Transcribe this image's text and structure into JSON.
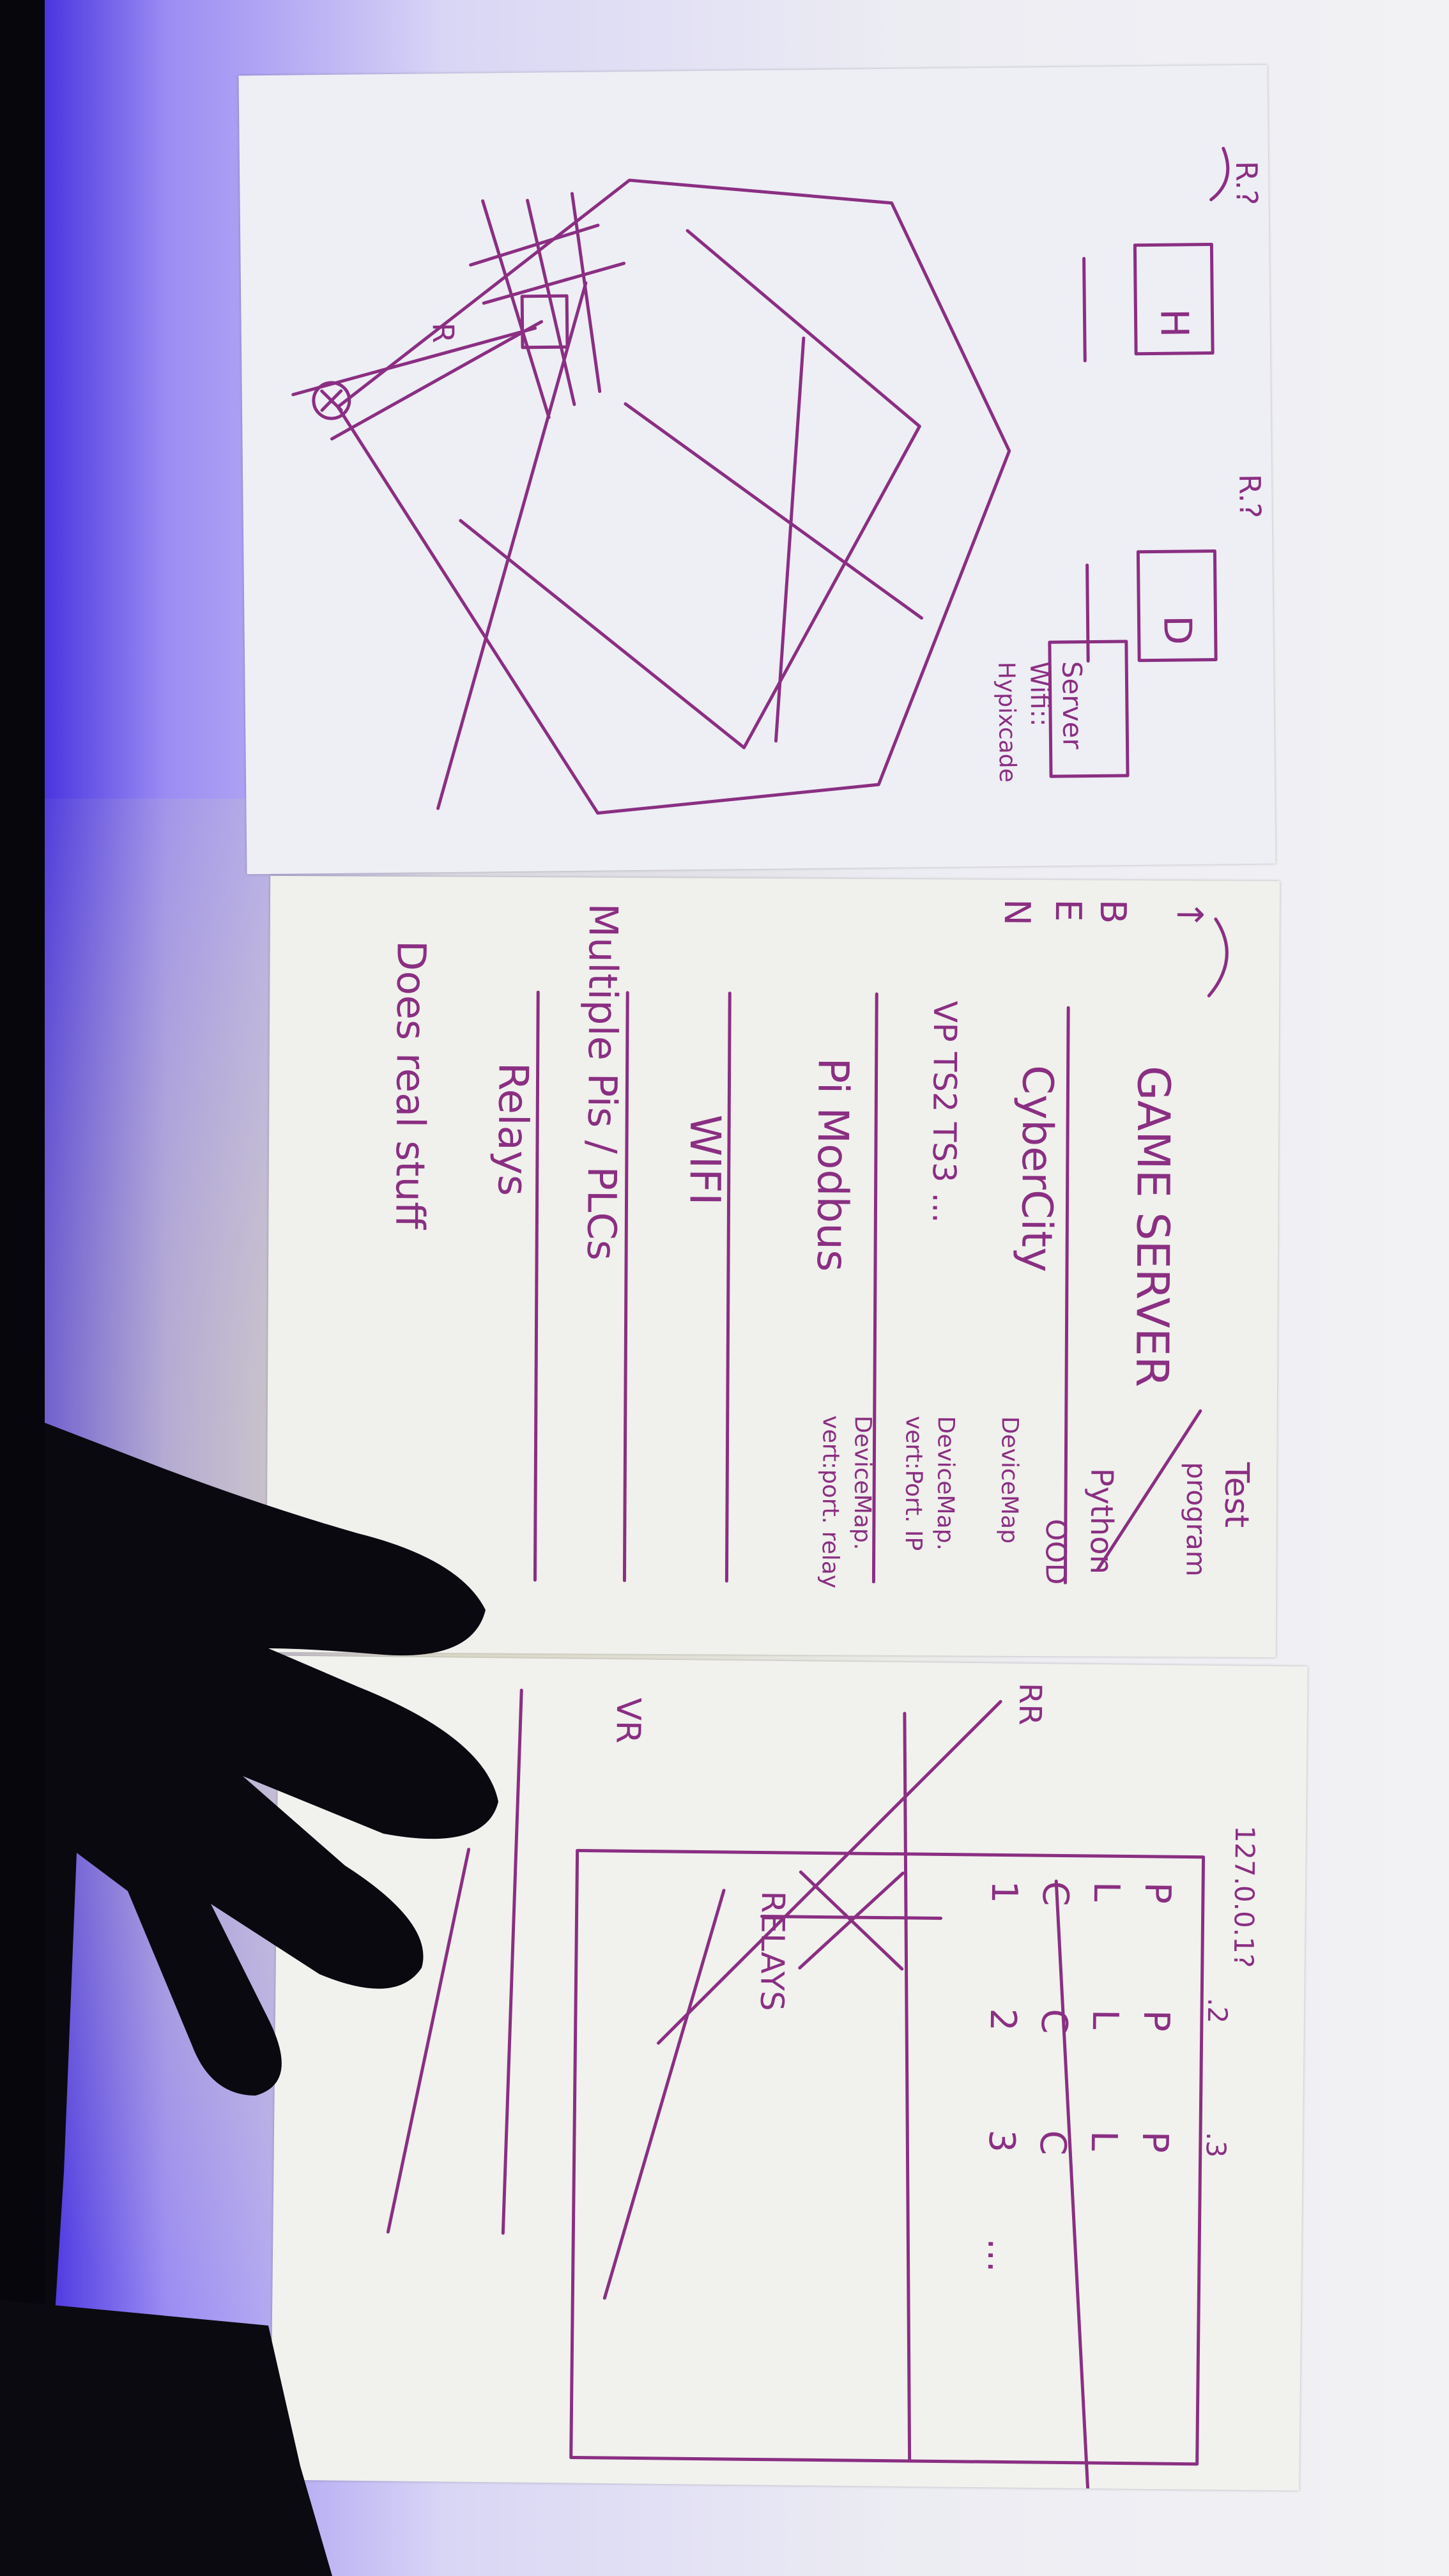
{
  "image_kind": "photo of three hand-drawn whiteboard-style sheets, photographed rotated 90 degrees",
  "ink_color": "#8a2f82",
  "sheet1": {
    "notes": [
      "R.?",
      "R.?",
      "H",
      "D",
      "R",
      "Server",
      "Wifi::",
      "Hypixcade"
    ]
  },
  "sheet2": {
    "left_column": [
      "↑",
      "B",
      "E",
      "N"
    ],
    "title": "GAME SERVER",
    "lines": [
      "CyberCity",
      "VP  TS2 TS3 ...",
      "Pi Modbus",
      "WIFI",
      "Multiple Pis / PLCs",
      "Relays",
      "Does real stuff"
    ],
    "right_notes": [
      "Test",
      "program",
      "Python",
      "OOD",
      "DeviceMap",
      "DeviceMap.",
      "vert:Port. IP",
      "DeviceMap.",
      "vert:port. relay"
    ]
  },
  "sheet3": {
    "labels": [
      "RR",
      "VR",
      "127.0.0.1?",
      ".2",
      ".3",
      "RELAYS"
    ],
    "grid_rows": [
      [
        "P",
        "P",
        "P"
      ],
      [
        "L",
        "L",
        "L"
      ],
      [
        "C",
        "C",
        "C"
      ],
      [
        "1",
        "2",
        "3",
        "..."
      ]
    ]
  }
}
